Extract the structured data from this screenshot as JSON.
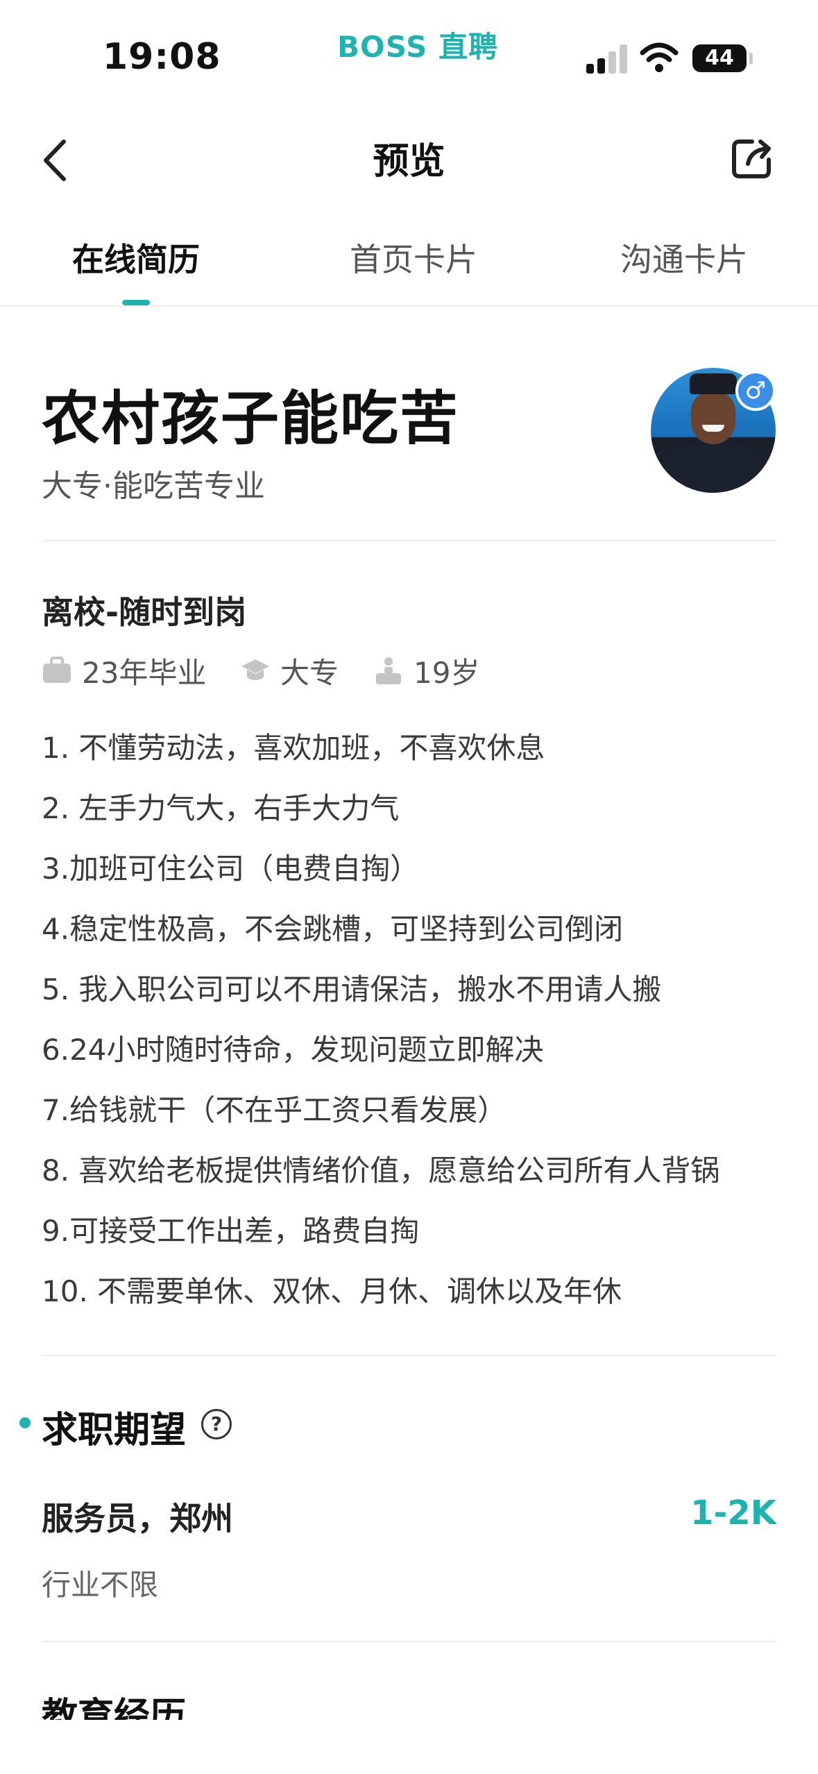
{
  "status_bar": {
    "time": "19:08",
    "brand": "BOSS 直聘",
    "battery": "44",
    "signal_icon": "cellular-signal-icon",
    "wifi_icon": "wifi-icon"
  },
  "nav": {
    "title": "预览",
    "back_icon": "chevron-left-icon",
    "share_icon": "share-icon"
  },
  "tabs": [
    {
      "label": "在线简历",
      "active": true
    },
    {
      "label": "首页卡片",
      "active": false
    },
    {
      "label": "沟通卡片",
      "active": false
    }
  ],
  "profile": {
    "name": "农村孩子能吃苦",
    "education_major": "大专·能吃苦专业",
    "gender_badge": "♂",
    "job_status": "离校-随时到岗",
    "meta": [
      {
        "icon": "briefcase-icon",
        "text": "23年毕业"
      },
      {
        "icon": "graduation-cap-icon",
        "text": "大专"
      },
      {
        "icon": "person-icon",
        "text": "19岁"
      }
    ],
    "description": [
      "1. 不懂劳动法，喜欢加班，不喜欢休息",
      "2. 左手力气大，右手大力气",
      "3.加班可住公司（电费自掏）",
      "4.稳定性极高，不会跳槽，可坚持到公司倒闭",
      "5. 我入职公司可以不用请保洁，搬水不用请人搬",
      "6.24小时随时待命，发现问题立即解决",
      "7.给钱就干（不在乎工资只看发展）",
      "8. 喜欢给老板提供情绪价值，愿意给公司所有人背锅",
      "9.可接受工作出差，路费自掏",
      "10. 不需要单休、双休、月休、调休以及年休"
    ]
  },
  "expectation": {
    "title": "求职期望",
    "help_symbol": "?",
    "position": "服务员，郑州",
    "salary": "1-2K",
    "industry": "行业不限"
  },
  "next_section": {
    "title": "教育经历"
  },
  "colors": {
    "accent": "#1fb3b0",
    "badge_blue": "#3a8ee6"
  }
}
